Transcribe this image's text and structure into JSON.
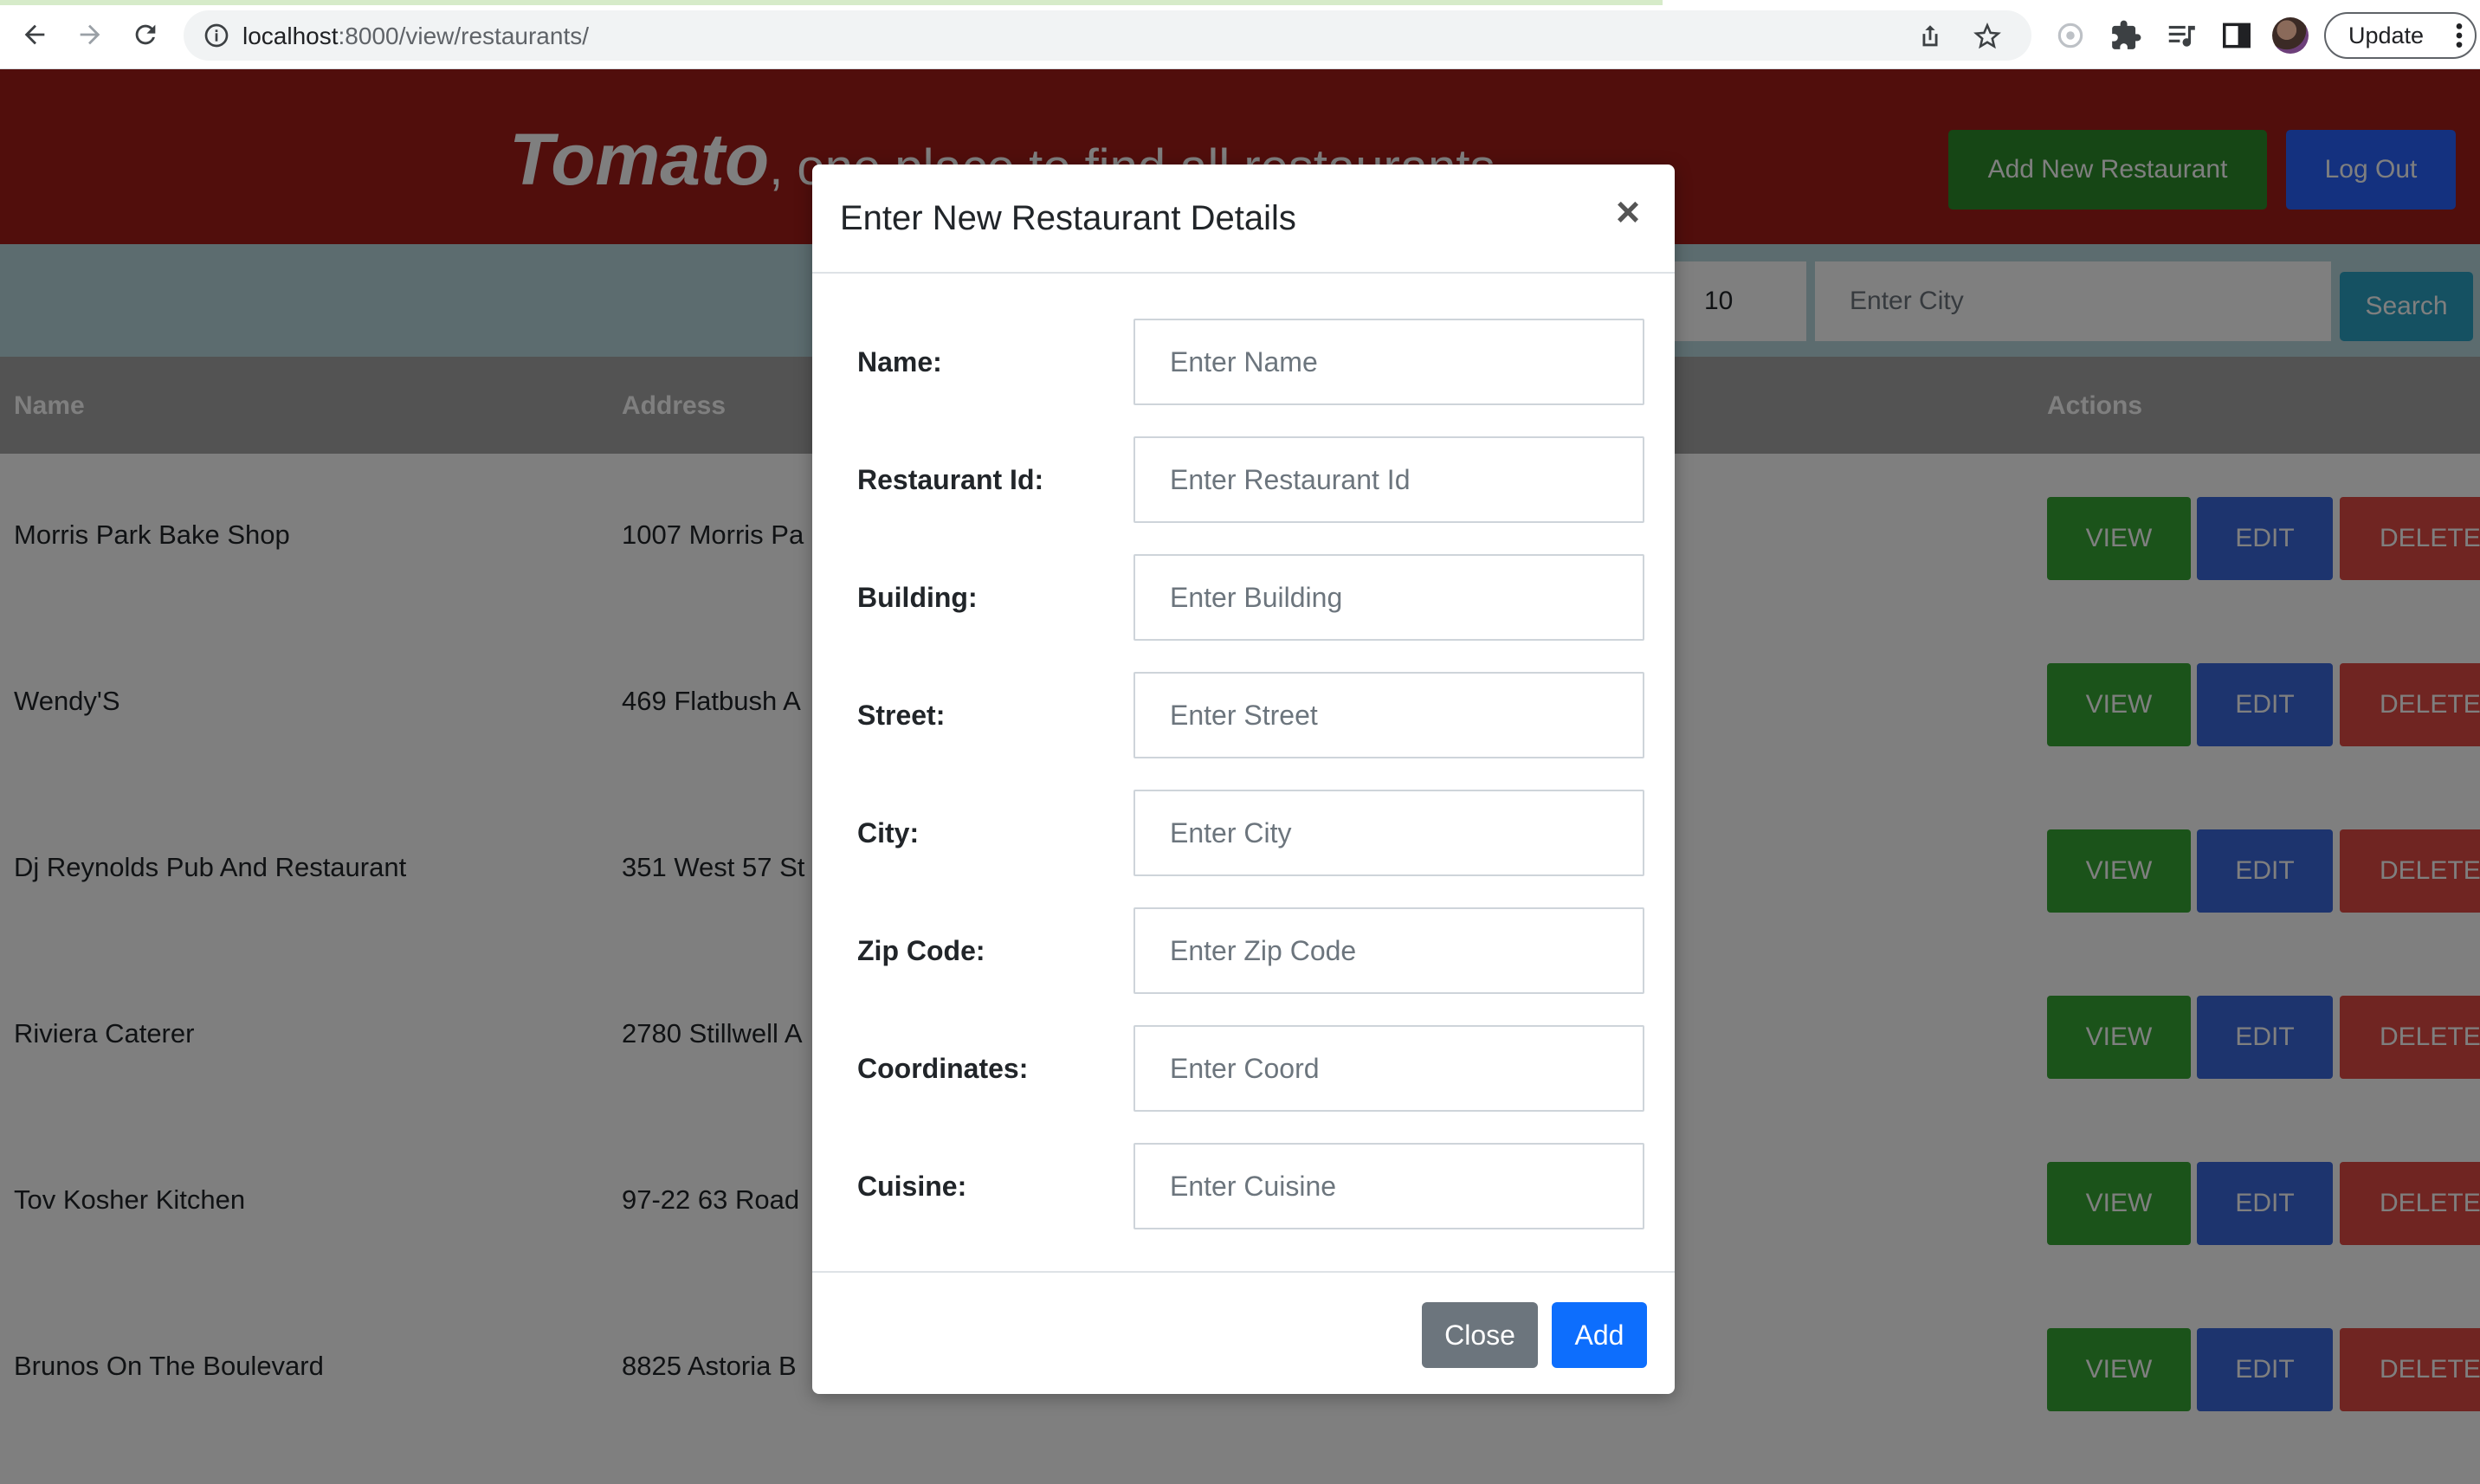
{
  "browser": {
    "url_host": "localhost",
    "url_path": ":8000/view/restaurants/",
    "update_label": "Update"
  },
  "header": {
    "logo": "Tomato",
    "tagline": ", one place to find all restaurants",
    "add_button": "Add New Restaurant",
    "logout_button": "Log Out"
  },
  "search": {
    "zip_value": "10",
    "city_placeholder": "Enter City",
    "button": "Search"
  },
  "table": {
    "columns": [
      "Name",
      "Address",
      "Actions"
    ],
    "rows": [
      {
        "name": "Morris Park Bake Shop",
        "address": "1007 Morris Pa"
      },
      {
        "name": "Wendy'S",
        "address": "469 Flatbush A"
      },
      {
        "name": "Dj Reynolds Pub And Restaurant",
        "address": "351 West 57 St"
      },
      {
        "name": "Riviera Caterer",
        "address": "2780 Stillwell A"
      },
      {
        "name": "Tov Kosher Kitchen",
        "address": "97-22 63 Road"
      },
      {
        "name": "Brunos On The Boulevard",
        "address": "8825 Astoria B"
      }
    ],
    "actions": {
      "view": "VIEW",
      "edit": "EDIT",
      "delete": "DELETE"
    }
  },
  "modal": {
    "title": "Enter New Restaurant Details",
    "close_symbol": "×",
    "fields": [
      {
        "label": "Name:",
        "placeholder": "Enter Name"
      },
      {
        "label": "Restaurant Id:",
        "placeholder": "Enter Restaurant Id"
      },
      {
        "label": "Building:",
        "placeholder": "Enter Building"
      },
      {
        "label": "Street:",
        "placeholder": "Enter Street"
      },
      {
        "label": "City:",
        "placeholder": "Enter City"
      },
      {
        "label": "Zip Code:",
        "placeholder": "Enter Zip Code"
      },
      {
        "label": "Coordinates:",
        "placeholder": "Enter Coord"
      },
      {
        "label": "Cuisine:",
        "placeholder": "Enter Cuisine"
      }
    ],
    "close_button": "Close",
    "add_button": "Add"
  }
}
